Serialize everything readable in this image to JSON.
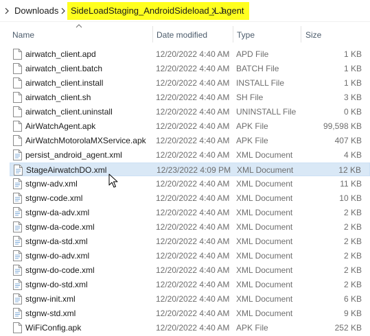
{
  "breadcrumb": {
    "items": [
      {
        "label": "Downloads",
        "highlighted": false
      },
      {
        "label": "SideLoadStaging_AndroidSideload_LJ",
        "highlighted": true
      },
      {
        "label": "agent",
        "highlighted": true
      }
    ],
    "highlight_color": "#ffff1f"
  },
  "columns": {
    "name": "Name",
    "date": "Date modified",
    "type": "Type",
    "size": "Size"
  },
  "files": [
    {
      "name": "airwatch_client.apd",
      "date": "12/20/2022 4:40 AM",
      "type": "APD File",
      "size": "1 KB",
      "icon": "generic-file-icon",
      "selected": false
    },
    {
      "name": "airwatch_client.batch",
      "date": "12/20/2022 4:40 AM",
      "type": "BATCH File",
      "size": "1 KB",
      "icon": "generic-file-icon",
      "selected": false
    },
    {
      "name": "airwatch_client.install",
      "date": "12/20/2022 4:40 AM",
      "type": "INSTALL File",
      "size": "1 KB",
      "icon": "generic-file-icon",
      "selected": false
    },
    {
      "name": "airwatch_client.sh",
      "date": "12/20/2022 4:40 AM",
      "type": "SH File",
      "size": "3 KB",
      "icon": "generic-file-icon",
      "selected": false
    },
    {
      "name": "airwatch_client.uninstall",
      "date": "12/20/2022 4:40 AM",
      "type": "UNINSTALL File",
      "size": "0 KB",
      "icon": "generic-file-icon",
      "selected": false
    },
    {
      "name": "AirWatchAgent.apk",
      "date": "12/20/2022 4:40 AM",
      "type": "APK File",
      "size": "99,598 KB",
      "icon": "generic-file-icon",
      "selected": false
    },
    {
      "name": "AirWatchMotorolaMXService.apk",
      "date": "12/20/2022 4:40 AM",
      "type": "APK File",
      "size": "407 KB",
      "icon": "generic-file-icon",
      "selected": false
    },
    {
      "name": "persist_android_agent.xml",
      "date": "12/20/2022 4:40 AM",
      "type": "XML Document",
      "size": "4 KB",
      "icon": "xml-file-icon",
      "selected": false
    },
    {
      "name": "StageAirwatchDO.xml",
      "date": "12/23/2022 4:09 PM",
      "type": "XML Document",
      "size": "12 KB",
      "icon": "xml-file-icon",
      "selected": true
    },
    {
      "name": "stgnw-adv.xml",
      "date": "12/20/2022 4:40 AM",
      "type": "XML Document",
      "size": "11 KB",
      "icon": "xml-file-icon",
      "selected": false
    },
    {
      "name": "stgnw-code.xml",
      "date": "12/20/2022 4:40 AM",
      "type": "XML Document",
      "size": "10 KB",
      "icon": "xml-file-icon",
      "selected": false
    },
    {
      "name": "stgnw-da-adv.xml",
      "date": "12/20/2022 4:40 AM",
      "type": "XML Document",
      "size": "2 KB",
      "icon": "xml-file-icon",
      "selected": false
    },
    {
      "name": "stgnw-da-code.xml",
      "date": "12/20/2022 4:40 AM",
      "type": "XML Document",
      "size": "2 KB",
      "icon": "xml-file-icon",
      "selected": false
    },
    {
      "name": "stgnw-da-std.xml",
      "date": "12/20/2022 4:40 AM",
      "type": "XML Document",
      "size": "2 KB",
      "icon": "xml-file-icon",
      "selected": false
    },
    {
      "name": "stgnw-do-adv.xml",
      "date": "12/20/2022 4:40 AM",
      "type": "XML Document",
      "size": "2 KB",
      "icon": "xml-file-icon",
      "selected": false
    },
    {
      "name": "stgnw-do-code.xml",
      "date": "12/20/2022 4:40 AM",
      "type": "XML Document",
      "size": "2 KB",
      "icon": "xml-file-icon",
      "selected": false
    },
    {
      "name": "stgnw-do-std.xml",
      "date": "12/20/2022 4:40 AM",
      "type": "XML Document",
      "size": "2 KB",
      "icon": "xml-file-icon",
      "selected": false
    },
    {
      "name": "stgnw-init.xml",
      "date": "12/20/2022 4:40 AM",
      "type": "XML Document",
      "size": "6 KB",
      "icon": "xml-file-icon",
      "selected": false
    },
    {
      "name": "stgnw-std.xml",
      "date": "12/20/2022 4:40 AM",
      "type": "XML Document",
      "size": "9 KB",
      "icon": "xml-file-icon",
      "selected": false
    },
    {
      "name": "WiFiConfig.apk",
      "date": "12/20/2022 4:40 AM",
      "type": "APK File",
      "size": "252 KB",
      "icon": "generic-file-icon",
      "selected": false
    }
  ],
  "colors": {
    "selection": "#d9e8f6",
    "header_text": "#4a5a6a",
    "secondary_text": "#6d6d6d"
  }
}
